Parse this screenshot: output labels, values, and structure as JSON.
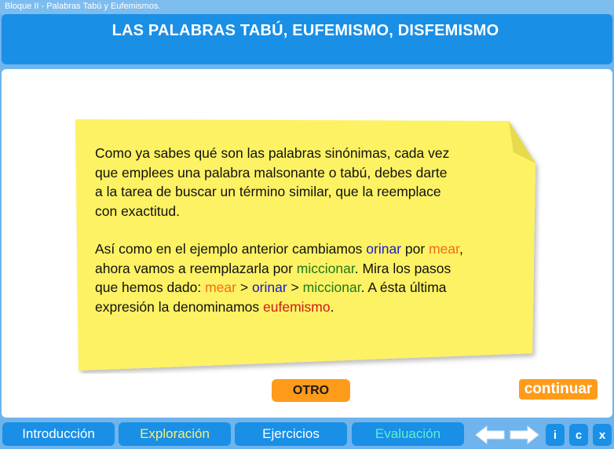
{
  "window": {
    "breadcrumb": "Bloque II  -  Palabras Tabú y Eufemismos."
  },
  "header": {
    "title": "LAS PALABRAS TABÚ, EUFEMISMO,  DISFEMISMO"
  },
  "note": {
    "paragraph1": [
      "Como ya sabes qué son las palabras sinónimas, cada vez",
      "que emplees una palabra malsonante o tabú, debes darte",
      "a la tarea de buscar un término similar, que la reemplace",
      "con exactitud."
    ],
    "p2": {
      "l1a": "Así como en el ejemplo anterior cambiamos ",
      "l1b": "orinar",
      "l1c": " por ",
      "l1d": "mear",
      "l1e": ",",
      "l2a": "ahora vamos a reemplazarla por ",
      "l2b": "miccionar",
      "l2c": ". Mira los pasos",
      "l3a": "que hemos dado: ",
      "l3b": "mear",
      "l3c": " > ",
      "l3d": "orinar",
      "l3e": "  > ",
      "l3f": "miccionar",
      "l3g": ". A ésta última",
      "l4a": "expresión la denominamos ",
      "l4b": "eufemismo",
      "l4c": "."
    },
    "colors": {
      "note_fill": "#fdf264",
      "orinar": "#1a1acc",
      "mear": "#f26b1d",
      "miccionar": "#1e7a1e",
      "eufemismo": "#cc1a1a"
    }
  },
  "actions": {
    "otro_label": "OTRO",
    "continuar_label": "continuar"
  },
  "nav": {
    "tabs": [
      {
        "label": "Introducción"
      },
      {
        "label": "Exploración"
      },
      {
        "label": "Ejercicios"
      },
      {
        "label": "Evaluación"
      }
    ],
    "prev_icon": "arrow-left-icon",
    "next_icon": "arrow-right-icon",
    "buttons": [
      {
        "label": "i"
      },
      {
        "label": "c"
      },
      {
        "label": "x"
      }
    ]
  },
  "theme": {
    "accent": "#1a8fe6",
    "background": "#6fb4ec",
    "button_orange": "#ff9b1a"
  }
}
